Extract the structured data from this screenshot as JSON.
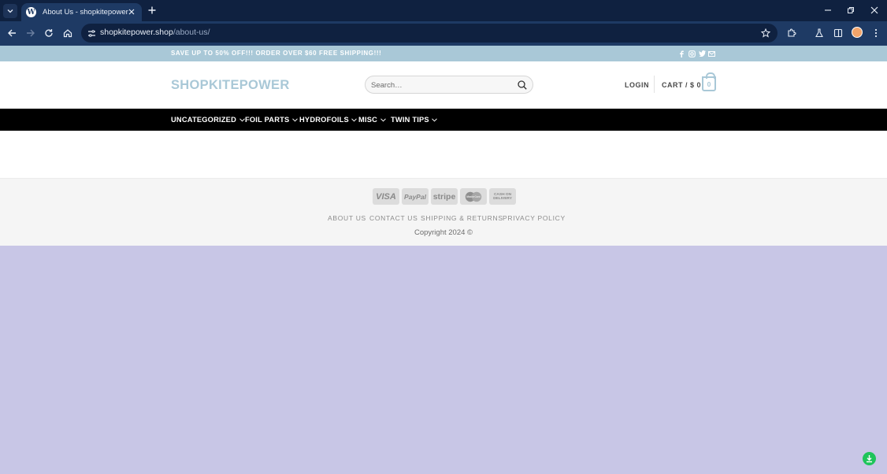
{
  "browser": {
    "tab_title": "About Us - shopkitepower",
    "favicon_glyph": "W",
    "url_host": "shopkitepower.shop",
    "url_path": "/about-us/"
  },
  "site": {
    "topbar_text": "SAVE UP TO 50% OFF!!! ORDER OVER $60 FREE SHIPPING!!!",
    "social_icons": [
      "facebook-icon",
      "instagram-icon",
      "twitter-icon",
      "email-icon"
    ],
    "logo": "SHOPKITEPOWER",
    "search_placeholder": "Search…",
    "login": "LOGIN",
    "cart_label": "CART / $ 0",
    "cart_count": "0",
    "nav": [
      {
        "label": "UNCATEGORIZED"
      },
      {
        "label": "FOIL PARTS"
      },
      {
        "label": "HYDROFOILS"
      },
      {
        "label": "MISC"
      },
      {
        "label": "TWIN TIPS"
      }
    ],
    "payment_icons": [
      "VISA",
      "PayPal",
      "stripe",
      "MasterCard",
      "CASH ON DELIVERY"
    ],
    "footer_links": [
      "ABOUT US",
      "CONTACT US",
      "SHIPPING & RETURNS",
      "PRIVACY POLICY"
    ],
    "copyright": "Copyright 2024 ©"
  },
  "colors": {
    "accent": "#a9c8d7",
    "nav_bg": "#000000",
    "page_bg": "#c8c6e6",
    "browser_frame": "#1e3a64"
  }
}
